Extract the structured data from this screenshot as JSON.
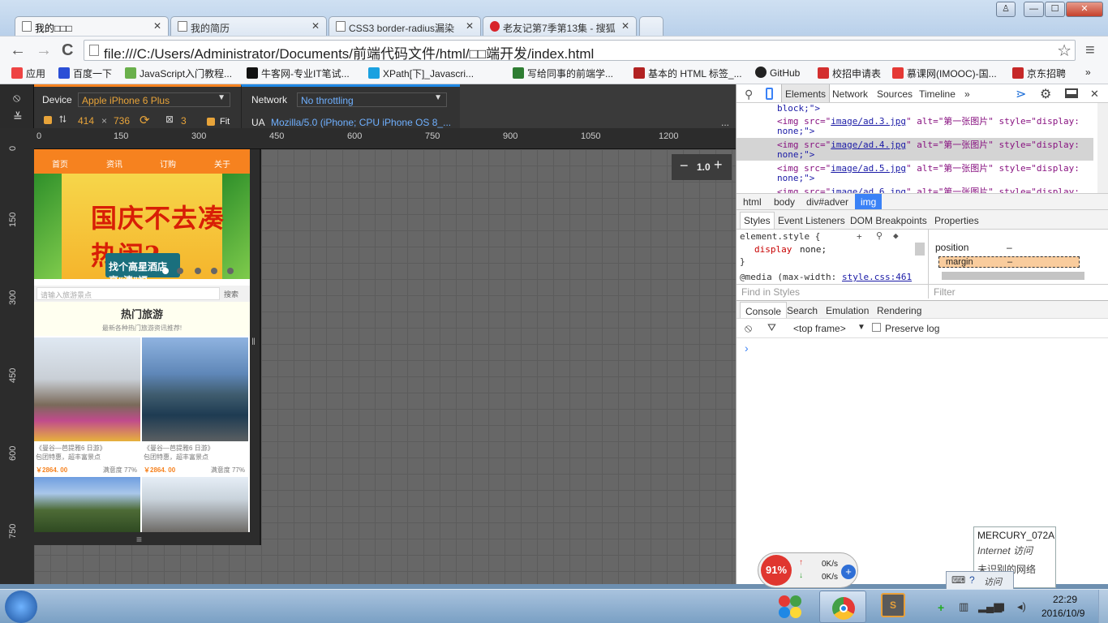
{
  "tabs": [
    {
      "label": "我的□□□",
      "active": true
    },
    {
      "label": "我的简历"
    },
    {
      "label": "CSS3 border-radius漏染"
    },
    {
      "label": "老友记第7季第13集 - 搜狐"
    }
  ],
  "window": {
    "minimize": "—",
    "maximize": "☐",
    "close": "✕",
    "user": "♙"
  },
  "toolbar": {
    "back": "←",
    "forward": "→",
    "reload": "C",
    "url": "file:///C:/Users/Administrator/Documents/前端代码文件/html/□□端开发/index.html",
    "star": "☆",
    "menu": "≡"
  },
  "bookmarks": [
    {
      "label": "应用",
      "color": "#e44"
    },
    {
      "label": "百度一下",
      "color": "#2b4fd6"
    },
    {
      "label": "JavaScript入门教程...",
      "color": "#6ab04c"
    },
    {
      "label": "牛客网-专业IT笔试...",
      "color": "#111"
    },
    {
      "label": "XPath[下]_Javascri...",
      "color": "#1aa1e0"
    },
    {
      "label": "写给同事的前端学...",
      "color": "#2e7d32"
    },
    {
      "label": "基本的 HTML 标签_...",
      "color": "#b22222"
    },
    {
      "label": "GitHub",
      "color": "#222"
    },
    {
      "label": "校招申请表",
      "color": "#d32f2f"
    },
    {
      "label": "慕课网(IMOOC)-国...",
      "color": "#e53935"
    },
    {
      "label": "京东招聘",
      "color": "#c62828"
    }
  ],
  "bookmarks_more": "»",
  "device": {
    "device_label": "Device",
    "device_value": "Apple iPhone 6 Plus",
    "width": "414",
    "times": "×",
    "height": "736",
    "ratio": "3",
    "fit": "Fit",
    "network_label": "Network",
    "network_value": "No throttling",
    "ua_label": "UA",
    "ua_value": "Mozilla/5.0 (iPhone; CPU iPhone OS 8_...",
    "more": "..."
  },
  "ruler": {
    "top": [
      "0",
      "150",
      "300",
      "450",
      "600",
      "750",
      "900",
      "1050",
      "1200"
    ],
    "left": [
      "0",
      "150",
      "300",
      "450",
      "600",
      "750"
    ]
  },
  "zoom": {
    "minus": "−",
    "value": "1.0",
    "plus": "+"
  },
  "phone": {
    "nav": [
      "首页",
      "资讯",
      "订购",
      "关于"
    ],
    "banner_title": "国庆不去凑热闹?",
    "banner_sub": "找个高星酒店享“清”福",
    "search_placeholder": "请输入旅游景点",
    "search_button": "搜索",
    "hot_title": "热门旅游",
    "hot_sub": "最新各种热门旅游资讯推荐!",
    "cards": [
      {
        "t1": "《曼谷—芭提雅6 日游》",
        "t2": "包团特惠，超丰富景点",
        "price": "￥2864. 00",
        "sat": "满意度  77%"
      },
      {
        "t1": "《曼谷—芭提雅6 日游》",
        "t2": "包团特惠，超丰富景点",
        "price": "￥2864. 00",
        "sat": "满意度  77%"
      }
    ],
    "handle_h": "≡",
    "handle_v": "‖"
  },
  "devtools": {
    "tabs": [
      "Elements",
      "Network",
      "Sources",
      "Timeline"
    ],
    "more": "»",
    "console_icon": "⋗",
    "code": [
      {
        "pre": "block;\">",
        "tag": "",
        "src": "",
        "alt": "",
        "style": ""
      },
      {
        "pre": "",
        "tag": "<img src=\"",
        "src": "image/ad.3.jpg",
        "alt": "\" alt=\"第一张图片\" style=\"display:",
        "style": "none;\">"
      },
      {
        "pre": "",
        "tag": "<img src=\"",
        "src": "image/ad.4.jpg",
        "alt": "\" alt=\"第一张图片\" style=\"display:",
        "style": "none;\">"
      },
      {
        "pre": "",
        "tag": "<img src=\"",
        "src": "image/ad.5.jpg",
        "alt": "\" alt=\"第一张图片\" style=\"display:",
        "style": "none;\">"
      },
      {
        "pre": "",
        "tag": "<img src=\"",
        "src": "image/ad.6.jpg",
        "alt": "\" alt=\"第一张图片\" style=\"display:",
        "style": ""
      }
    ],
    "breadcrumbs": [
      "html",
      "body",
      "div#adver",
      "img"
    ],
    "styles_tabs": [
      "Styles",
      "Event Listeners",
      "DOM Breakpoints",
      "Properties"
    ],
    "style_rule": "element.style {",
    "style_prop": "display",
    "style_val": "none;",
    "style_close": "}",
    "media": "@media (max-width:",
    "media_link": "style.css:461",
    "find_styles": "Find in Styles",
    "box_position": "position",
    "box_dash": "–",
    "box_margin": "margin",
    "filter": "Filter",
    "drawer_tabs": [
      "Console",
      "Search",
      "Emulation",
      "Rendering"
    ],
    "frame": "<top frame>",
    "preserve": "Preserve log",
    "prompt": "›"
  },
  "taskbar": {
    "time": "22:29",
    "date": "2016/10/9",
    "speed_percent": "91%",
    "up": "0K/s",
    "down": "0K/s",
    "wifi_name": "MERCURY_072A",
    "wifi_status": "Internet 访问",
    "net2": "未识别的网络",
    "net2_status": "访问"
  }
}
